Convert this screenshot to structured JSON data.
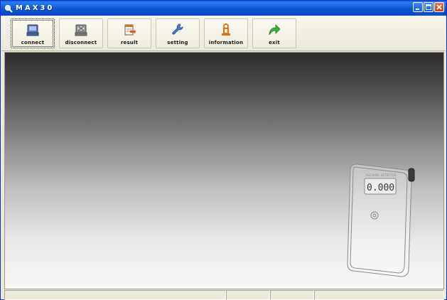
{
  "window": {
    "title": "MAX30"
  },
  "toolbar": {
    "buttons": [
      {
        "label": "connect",
        "icon": "connect-icon"
      },
      {
        "label": "disconnect",
        "icon": "disconnect-icon"
      },
      {
        "label": "result",
        "icon": "result-icon"
      },
      {
        "label": "setting",
        "icon": "wrench-icon"
      },
      {
        "label": "information",
        "icon": "information-icon"
      },
      {
        "label": "exit",
        "icon": "exit-arrow-icon"
      }
    ]
  },
  "device": {
    "display_reading": "0.000",
    "brand_text": "ALCOHOL DETECTOR"
  },
  "statusbar": {
    "cells": [
      "",
      "",
      "",
      ""
    ]
  }
}
